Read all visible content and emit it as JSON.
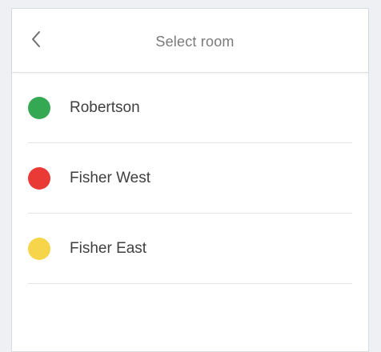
{
  "header": {
    "title": "Select room",
    "back_icon": "chevron-left-icon"
  },
  "rooms": [
    {
      "label": "Robertson",
      "color": "#34a853"
    },
    {
      "label": "Fisher West",
      "color": "#ea3a35"
    },
    {
      "label": "Fisher East",
      "color": "#f7d54a"
    }
  ]
}
